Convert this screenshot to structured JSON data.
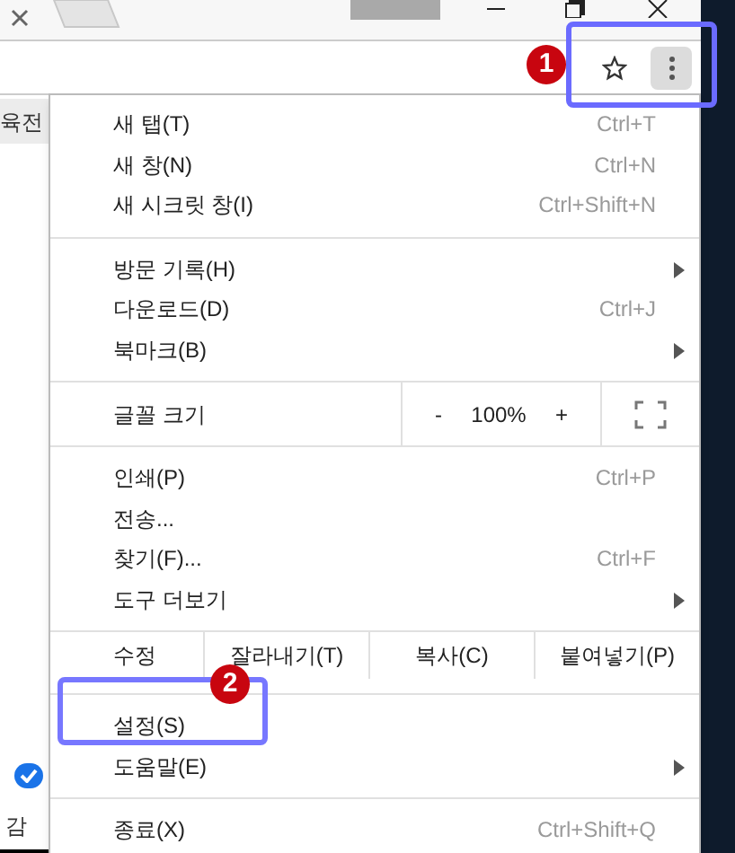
{
  "page": {
    "top_text": "육전",
    "checkbox": {
      "checked": true
    },
    "bottom_text": "감"
  },
  "menu": {
    "items": [
      {
        "kind": "item",
        "label": "새 탭(T)",
        "shortcut": "Ctrl+T",
        "submenu": false
      },
      {
        "kind": "item",
        "label": "새 창(N)",
        "shortcut": "Ctrl+N",
        "submenu": false
      },
      {
        "kind": "item",
        "label": "새 시크릿 창(I)",
        "shortcut": "Ctrl+Shift+N",
        "submenu": false
      },
      {
        "kind": "divider"
      },
      {
        "kind": "item",
        "label": "방문 기록(H)",
        "submenu": true
      },
      {
        "kind": "item",
        "label": "다운로드(D)",
        "shortcut": "Ctrl+J",
        "submenu": false
      },
      {
        "kind": "item",
        "label": "북마크(B)",
        "submenu": true
      },
      {
        "kind": "divider"
      },
      {
        "kind": "zoom",
        "label": "글꼴 크기",
        "minus": "-",
        "value": "100%",
        "plus": "+"
      },
      {
        "kind": "divider"
      },
      {
        "kind": "item",
        "label": "인쇄(P)",
        "shortcut": "Ctrl+P",
        "submenu": false
      },
      {
        "kind": "item",
        "label": "전송...",
        "submenu": false
      },
      {
        "kind": "item",
        "label": "찾기(F)...",
        "shortcut": "Ctrl+F",
        "submenu": false
      },
      {
        "kind": "item",
        "label": "도구 더보기",
        "submenu": true
      },
      {
        "kind": "divider"
      },
      {
        "kind": "edit",
        "label": "수정",
        "buttons": [
          "잘라내기(T)",
          "복사(C)",
          "붙여넣기(P)"
        ]
      },
      {
        "kind": "divider"
      },
      {
        "kind": "item",
        "label": "설정(S)",
        "submenu": false
      },
      {
        "kind": "item",
        "label": "도움말(E)",
        "submenu": true
      },
      {
        "kind": "divider"
      },
      {
        "kind": "item",
        "label": "종료(X)",
        "shortcut": "Ctrl+Shift+Q",
        "submenu": false
      }
    ]
  },
  "callouts": [
    {
      "number": "1"
    },
    {
      "number": "2"
    }
  ]
}
